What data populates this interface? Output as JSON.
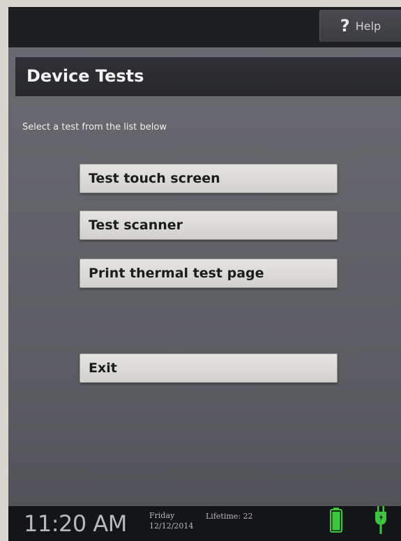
{
  "header": {
    "help_label": "Help",
    "help_icon": "question-mark-icon"
  },
  "title_bar": {
    "title": "Device Tests"
  },
  "main": {
    "instruction": "Select a test from the list below",
    "buttons": [
      {
        "label": "Test touch screen"
      },
      {
        "label": "Test scanner"
      },
      {
        "label": "Print thermal test page"
      },
      {
        "label": "Exit"
      }
    ]
  },
  "status_bar": {
    "time": "11:20 AM",
    "day": "Friday",
    "date": "12/12/2014",
    "lifetime_label": "Lifetime:",
    "lifetime_value": "22",
    "battery_icon": "battery-icon",
    "power_icon": "power-plug-icon"
  },
  "colors": {
    "accent_green": "#3ec43e",
    "button_face": "#dedcd9",
    "panel_gray": "#636469",
    "bar_dark": "#1e1f22"
  }
}
